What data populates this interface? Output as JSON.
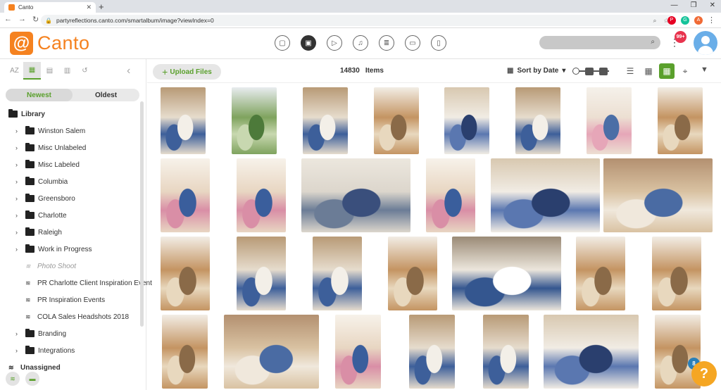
{
  "browser": {
    "tab_title": "Canto",
    "url": "partyreflections.canto.com/smartalbum/image?viewIndex=0",
    "ext_a_label": "A"
  },
  "app": {
    "brand": "Canto",
    "notification_badge": "99+",
    "search": {
      "placeholder": "",
      "value": ""
    }
  },
  "sidebar": {
    "sort_newest": "Newest",
    "sort_oldest": "Oldest",
    "tool_az": "AZ",
    "tree": [
      {
        "label": "Library",
        "type": "root",
        "chev": false
      },
      {
        "label": "Winston Salem",
        "type": "folder",
        "chev": true
      },
      {
        "label": "Misc Unlabeled",
        "type": "folder",
        "chev": true
      },
      {
        "label": "Misc Labeled",
        "type": "folder",
        "chev": true
      },
      {
        "label": "Columbia",
        "type": "folder",
        "chev": true
      },
      {
        "label": "Greensboro",
        "type": "folder",
        "chev": true
      },
      {
        "label": "Charlotte",
        "type": "folder",
        "chev": true
      },
      {
        "label": "Raleigh",
        "type": "folder",
        "chev": true
      },
      {
        "label": "Work in Progress",
        "type": "folder",
        "chev": true
      },
      {
        "label": "Photo Shoot",
        "type": "album-dim",
        "chev": false
      },
      {
        "label": "PR Charlotte Client Inspiration Event",
        "type": "album",
        "chev": false
      },
      {
        "label": "PR Inspiration Events",
        "type": "album",
        "chev": false
      },
      {
        "label": "COLA Sales Headshots 2018",
        "type": "album",
        "chev": false
      },
      {
        "label": "Branding",
        "type": "folder",
        "chev": true
      },
      {
        "label": "Integrations",
        "type": "folder",
        "chev": true
      },
      {
        "label": "Unassigned",
        "type": "album-bold",
        "chev": false
      }
    ]
  },
  "toolbar": {
    "upload_label": "Upload Files",
    "item_count": "14830",
    "items_label": "Items",
    "sort_label": "Sort by Date"
  },
  "help": {
    "label": "?",
    "badge": "8"
  },
  "colors": {
    "brand": "#f58220",
    "accent": "#5aa02c",
    "badge": "#e8344e"
  },
  "photos": [
    {
      "name": "table-setting-blue"
    },
    {
      "name": "garden-table"
    },
    {
      "name": "table-setting-blue"
    },
    {
      "name": "barn-hall"
    },
    {
      "name": "plate-closeup"
    },
    {
      "name": "table-setting-blue"
    },
    {
      "name": "table-setting-flowers"
    },
    {
      "name": "barn-hall"
    },
    {
      "name": "flowers-plate"
    },
    {
      "name": "flowers-plate"
    },
    {
      "name": "glassware"
    },
    {
      "name": "flowers-plate"
    },
    {
      "name": "plate-closeup"
    },
    {
      "name": "long-table"
    },
    {
      "name": "barn-hall"
    },
    {
      "name": "table-setting-blue"
    },
    {
      "name": "table-setting-blue"
    },
    {
      "name": "barn-hall"
    },
    {
      "name": "chairs-table"
    },
    {
      "name": "barn-hall"
    },
    {
      "name": "barn-hall"
    },
    {
      "name": "barn-hall"
    },
    {
      "name": "long-table"
    },
    {
      "name": "flowers-plate"
    },
    {
      "name": "table-setting-blue"
    },
    {
      "name": "table-setting-blue"
    },
    {
      "name": "plate-closeup"
    },
    {
      "name": "barn-hall"
    }
  ]
}
